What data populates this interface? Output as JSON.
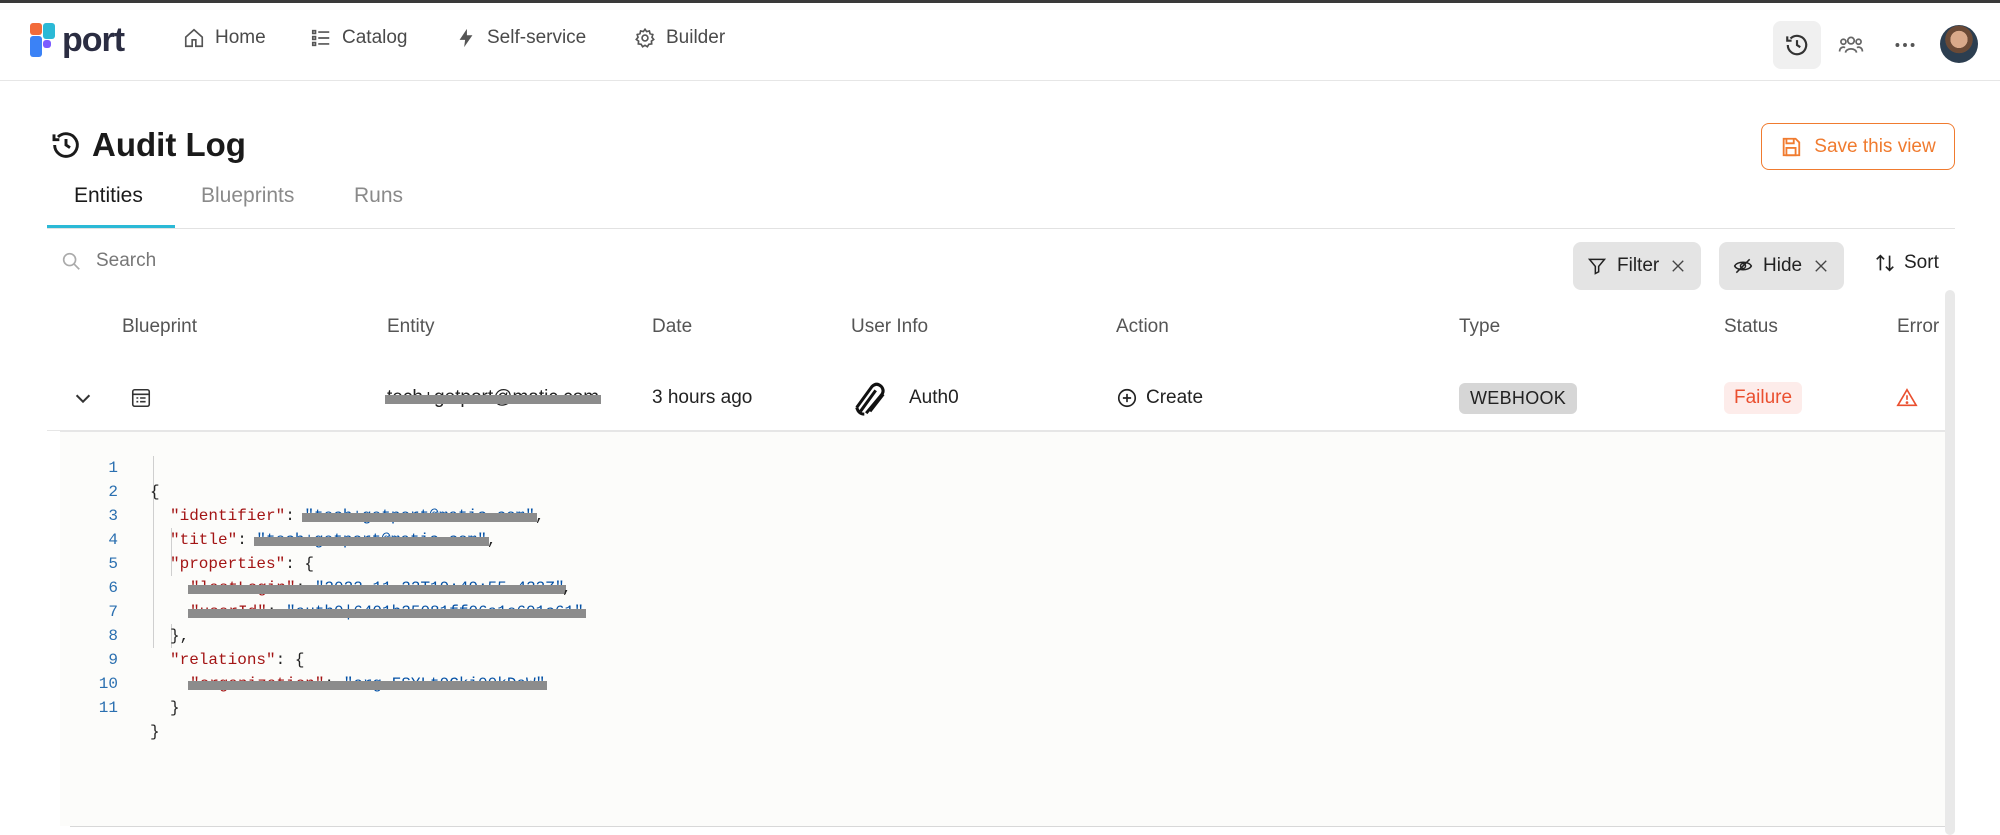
{
  "nav": {
    "logo_text": "port",
    "items": [
      {
        "label": "Home",
        "icon": "home-icon"
      },
      {
        "label": "Catalog",
        "icon": "list-icon"
      },
      {
        "label": "Self-service",
        "icon": "lightning-icon"
      },
      {
        "label": "Builder",
        "icon": "gear-icon"
      }
    ],
    "right_icons": [
      "history-icon",
      "users-icon",
      "more-icon"
    ]
  },
  "page": {
    "title": "Audit Log",
    "save_view_label": "Save this view",
    "tabs": [
      {
        "label": "Entities",
        "active": true
      },
      {
        "label": "Blueprints",
        "active": false
      },
      {
        "label": "Runs",
        "active": false
      }
    ]
  },
  "toolbar": {
    "search_placeholder": "Search",
    "filter_label": "Filter",
    "hide_label": "Hide",
    "sort_label": "Sort"
  },
  "table": {
    "columns": [
      "Blueprint",
      "Entity",
      "Date",
      "User Info",
      "Action",
      "Type",
      "Status",
      "Error"
    ],
    "row": {
      "entity": "tech+getport@matic.com",
      "date": "3 hours ago",
      "user": "Auth0",
      "action": "Create",
      "type": "WEBHOOK",
      "status": "Failure"
    }
  },
  "code": {
    "line_numbers": [
      "1",
      "2",
      "3",
      "4",
      "5",
      "6",
      "7",
      "8",
      "9",
      "10",
      "11"
    ],
    "keys": {
      "identifier": "\"identifier\"",
      "title": "\"title\"",
      "properties": "\"properties\"",
      "relations": "\"relations\""
    }
  },
  "colors": {
    "accent_orange": "#f07b2f",
    "tab_underline": "#2bb9d6",
    "failure_red": "#ea4f2f",
    "json_key": "#a31515",
    "json_string": "#0451a5"
  }
}
